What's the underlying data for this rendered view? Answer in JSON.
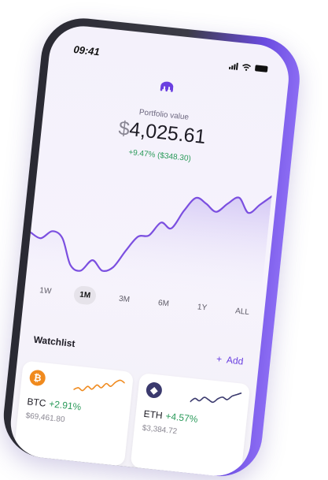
{
  "status_bar": {
    "time": "09:41"
  },
  "portfolio": {
    "label": "Portfolio value",
    "currency": "$",
    "amount": "4,025.61",
    "change": "+9.47% ($348.30)"
  },
  "chart_data": {
    "type": "area",
    "series": [
      {
        "values": [
          52,
          48,
          55,
          50,
          28,
          24,
          34,
          26,
          30,
          45,
          58,
          60,
          72,
          68,
          84,
          96,
          92,
          86,
          94,
          100,
          88,
          96,
          104
        ]
      }
    ],
    "ylim": [
      20,
      110
    ],
    "accent_color": "#7b4fe0"
  },
  "ranges": {
    "items": [
      "1W",
      "1M",
      "3M",
      "6M",
      "1Y",
      "ALL"
    ],
    "selected": "1M"
  },
  "watchlist": {
    "title": "Watchlist",
    "add_label": "Add",
    "coins": [
      {
        "symbol": "BTC",
        "change": "+2.91%",
        "price": "$69,461.80",
        "icon": "bitcoin-icon",
        "spark": [
          4,
          5,
          4,
          6,
          5,
          7,
          6,
          8,
          7,
          9,
          10,
          9
        ],
        "spark_color": "#f08a1e"
      },
      {
        "symbol": "ETH",
        "change": "+4.57%",
        "price": "$3,384.72",
        "icon": "ethereum-icon",
        "spark": [
          3,
          5,
          4,
          6,
          5,
          4,
          6,
          7,
          6,
          8,
          9,
          10
        ],
        "spark_color": "#3b3a6e"
      }
    ]
  },
  "colors": {
    "accent": "#6a3fe0",
    "positive": "#2a9a5a"
  }
}
